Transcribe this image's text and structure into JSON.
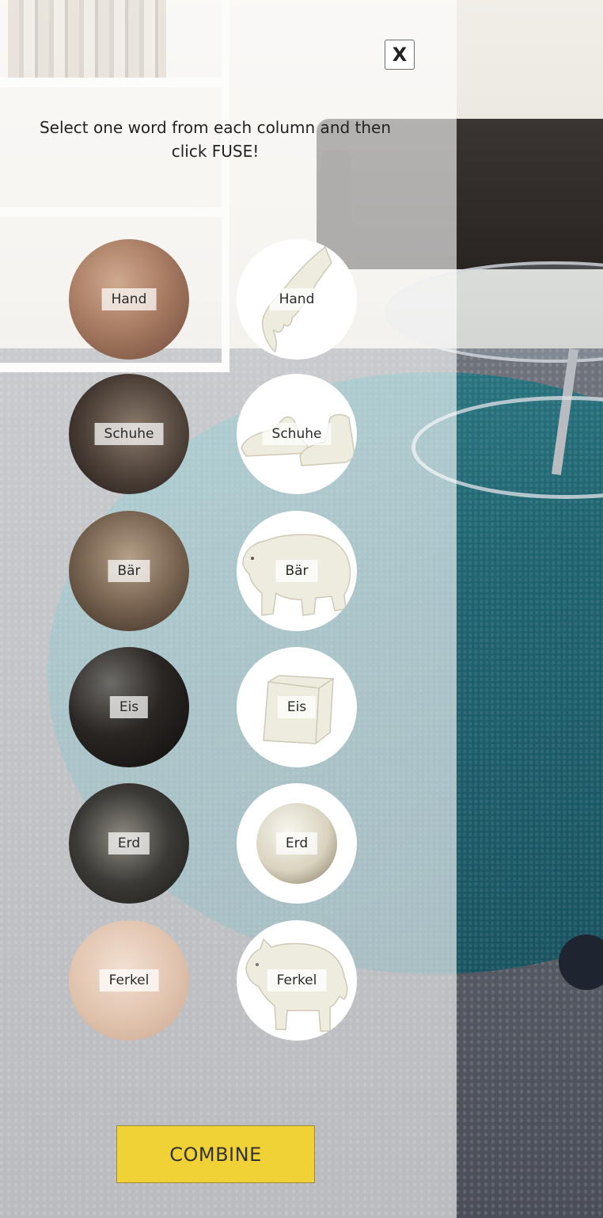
{
  "overlay": {
    "close_label": "X",
    "instruction": "Select one word from each column and then click FUSE!"
  },
  "materials": [
    {
      "label": "Hand",
      "texture": "skin"
    },
    {
      "label": "Schuhe",
      "texture": "leather"
    },
    {
      "label": "Bär",
      "texture": "fur"
    },
    {
      "label": "Eis",
      "texture": "dark"
    },
    {
      "label": "Erd",
      "texture": "earth"
    },
    {
      "label": "Ferkel",
      "texture": "pig-skin"
    }
  ],
  "shapes": [
    {
      "label": "Hand",
      "model": "hand-model"
    },
    {
      "label": "Schuhe",
      "model": "shoes-model"
    },
    {
      "label": "Bär",
      "model": "bear-model"
    },
    {
      "label": "Eis",
      "model": "cube-model"
    },
    {
      "label": "Erd",
      "model": "sphere-model"
    },
    {
      "label": "Ferkel",
      "model": "piglet-model"
    }
  ],
  "combine_label": "COMBINE",
  "colors": {
    "accent": "#f0d237",
    "model": "#eeebdf"
  }
}
